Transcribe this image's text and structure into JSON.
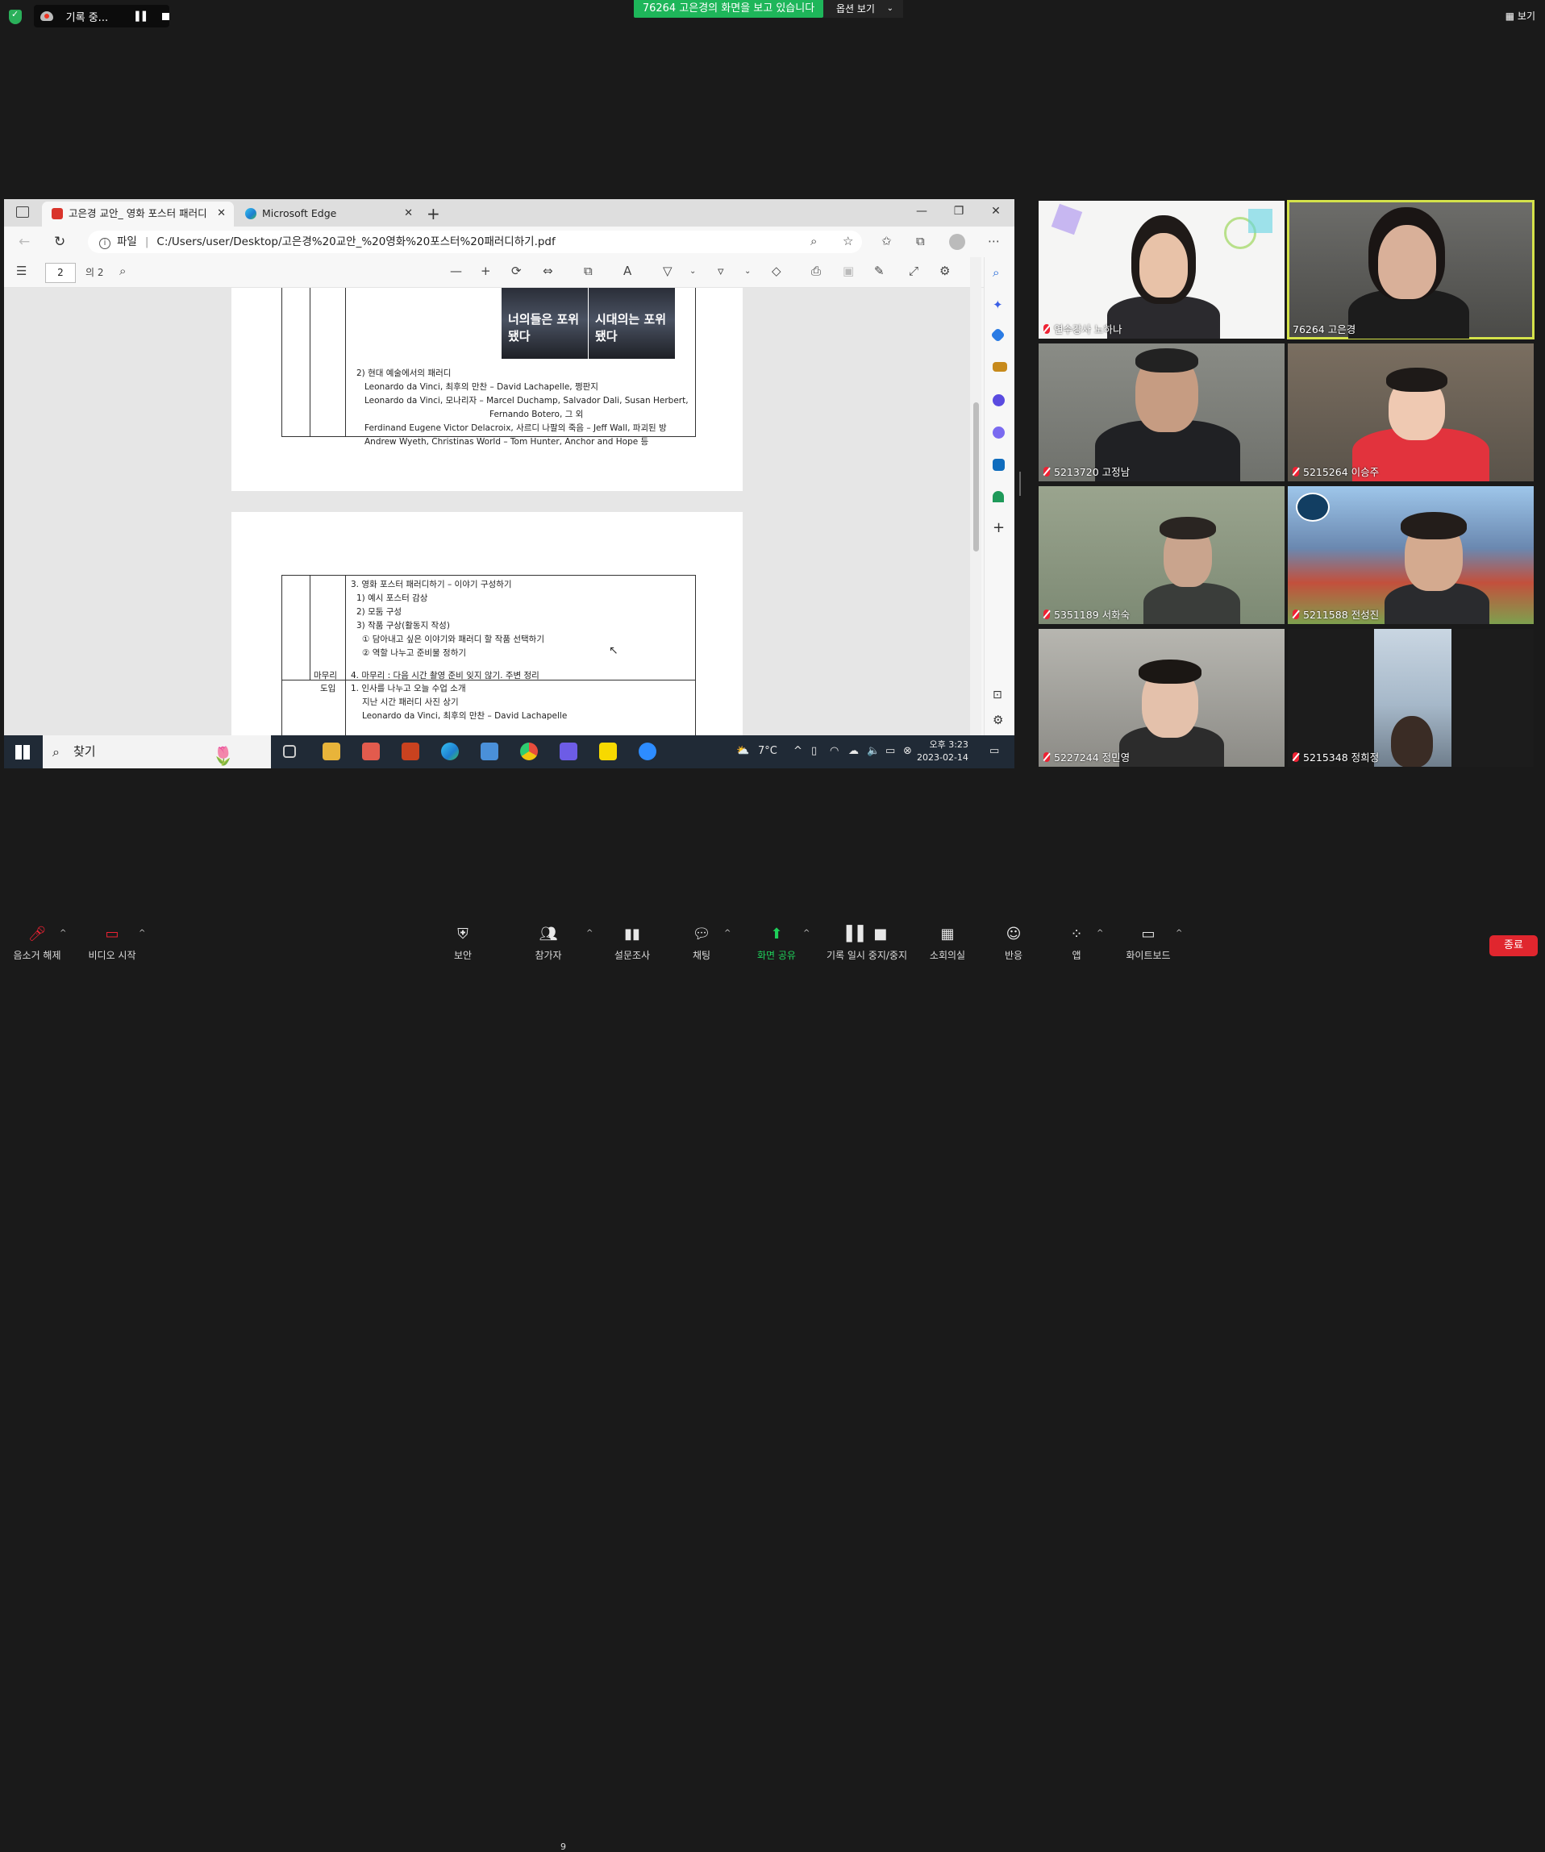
{
  "zoom": {
    "recording_label": "기록 중...",
    "share_banner": "76264 고은경의 화면을 보고 있습니다",
    "options_label": "옵션 보기",
    "view_label": "보기"
  },
  "browser": {
    "tabs": [
      {
        "title": "고은경 교안_ 영화 포스터 패러디",
        "active": true
      },
      {
        "title": "Microsoft Edge",
        "active": false
      }
    ],
    "address": {
      "scheme_label": "파일",
      "url": "C:/Users/user/Desktop/고은경%20교안_%20영화%20포스터%20패러디하기.pdf"
    },
    "pdf_toolbar": {
      "page_number": "2",
      "page_total": "의 2"
    }
  },
  "document": {
    "page1_lines": [
      "2) 현대 예술에서의 패러디",
      "Leonardo da Vinci, 최후의 만찬 – David Lachapelle, 쩡판지",
      "Leonardo da Vinci, 모나리자 – Marcel Duchamp, Salvador Dali, Susan Herbert,",
      "Fernando Botero, 그 외",
      "Ferdinand Eugene Victor Delacroix, 사르디 나팔의 죽음 – Jeff Wall, 파괴된 방",
      "Andrew Wyeth, Christinas World – Tom Hunter, Anchor and Hope 등"
    ],
    "poster_titles": [
      "너의들은 포위됐다",
      "시대의는 포위됐다"
    ],
    "page2_lines": [
      "3. 영화 포스터 패러디하기 – 이야기 구성하기",
      "1) 예시 포스터 감상",
      "2) 모둠 구성",
      "3) 작품 구상(활동지 작성)",
      "① 담아내고 싶은 이야기와 패러디 할 작품 선택하기",
      "② 역할 나누고 준비물 정하기"
    ],
    "row_wrapup_label": "마무리",
    "row_wrapup_text": "4. 마무리 : 다음 시간 촬영 준비 잊지 않기. 주변 정리",
    "row_intro_label": "도입",
    "row_intro_lines": [
      "1. 인사를 나누고 오늘 수업 소개",
      "지난 시간 패러디 사진 상기",
      "Leonardo da Vinci, 최후의 만찬 – David Lachapelle"
    ]
  },
  "taskbar": {
    "search_label": "찾기",
    "weather": "7°C",
    "time": "오후 3:23",
    "date": "2023-02-14"
  },
  "participants": [
    {
      "name": "연수강사 노하나",
      "muted": true,
      "active": false
    },
    {
      "name": "76264 고은경",
      "muted": false,
      "active": true
    },
    {
      "name": "5213720 고정남",
      "muted": true,
      "active": false
    },
    {
      "name": "5215264 이승주",
      "muted": true,
      "active": false
    },
    {
      "name": "5351189 서화숙",
      "muted": true,
      "active": false
    },
    {
      "name": "5211588 전성진",
      "muted": true,
      "active": false
    },
    {
      "name": "5227244 정민영",
      "muted": true,
      "active": false
    },
    {
      "name": "5215348 정희정",
      "muted": true,
      "active": false
    }
  ],
  "toolbar": {
    "unmute": "음소거 해제",
    "video": "비디오 시작",
    "security": "보안",
    "participants": "참가자",
    "participants_count": "9",
    "polls": "설문조사",
    "chat": "채팅",
    "share": "화면 공유",
    "pause_record": "기록 일시 중지/중지",
    "breakout": "소회의실",
    "reactions": "반응",
    "apps": "앱",
    "whiteboard": "화이트보드",
    "end": "종료"
  }
}
